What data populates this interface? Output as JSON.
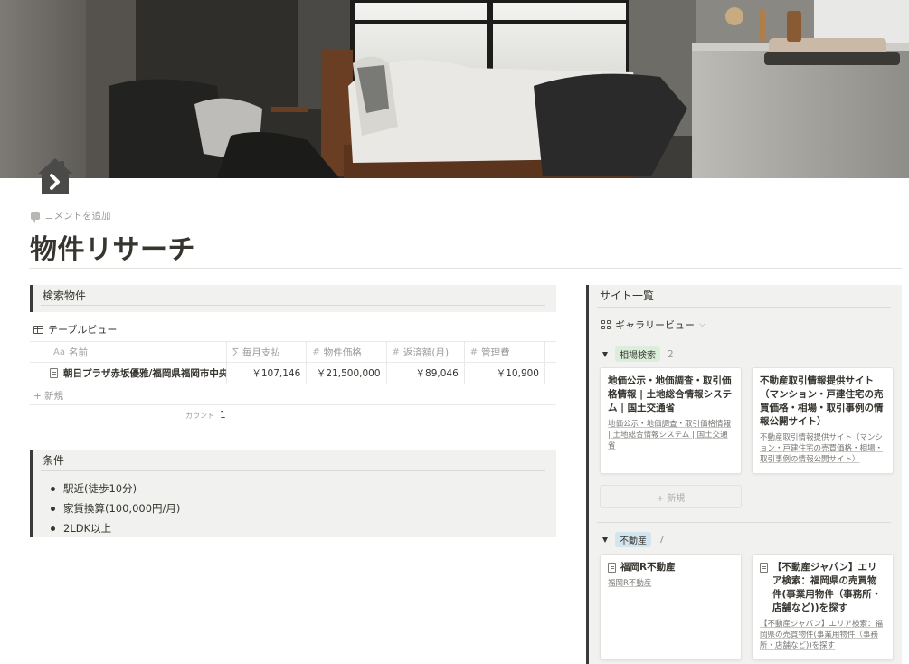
{
  "page": {
    "add_comment": "コメントを追加",
    "title": "物件リサーチ"
  },
  "search_section": {
    "heading": "検索物件",
    "view_label": "テーブルビュー",
    "columns": [
      {
        "icon": "Aa",
        "label": "名前"
      },
      {
        "icon": "∑",
        "label": "毎月支払"
      },
      {
        "icon": "#",
        "label": "物件価格"
      },
      {
        "icon": "#",
        "label": "返済額(月)"
      },
      {
        "icon": "#",
        "label": "管理費"
      }
    ],
    "rows": [
      {
        "name": "朝日プラザ赤坂優雅/福岡県福岡市中央区",
        "monthly": "￥107,146",
        "price": "￥21,500,000",
        "repayment": "￥89,046",
        "management": "￥10,900"
      }
    ],
    "new_label": "+ 新規",
    "count_label": "カウント",
    "count_value": "1"
  },
  "conditions": {
    "heading": "条件",
    "items": [
      "駅近(徒歩10分)",
      "家賃換算(100,000円/月)",
      "2LDK以上"
    ]
  },
  "sites": {
    "heading": "サイト一覧",
    "view_label": "ギャラリービュー",
    "groups": [
      {
        "tag": "相場検索",
        "count": "2",
        "cards": [
          {
            "title": "地価公示・地価調査・取引価格情報 | 土地総合情報システム | 国土交通省",
            "link": "地価公示・地価調査・取引価格情報 | 土地総合情報システム | 国土交通省"
          },
          {
            "title": "不動産取引情報提供サイト（マンション・戸建住宅の売買価格・相場・取引事例の情報公開サイト）",
            "link": "不動産取引情報提供サイト（マンション・戸建住宅の売買価格・相場・取引事例の情報公開サイト）"
          }
        ],
        "new_label": "+ 新規"
      },
      {
        "tag": "不動産",
        "count": "7",
        "cards": [
          {
            "title": "福岡R不動産",
            "link": "福岡R不動産"
          },
          {
            "title": "【不動産ジャパン】エリア検索：福岡県の売買物件(事業用物件（事務所・店舗など))を探す",
            "link": "【不動産ジャパン】エリア検索：福岡県の売買物件(事業用物件（事務所・店舗など))を探す"
          }
        ]
      }
    ]
  },
  "colors": {
    "text": "#37352f",
    "muted": "#9b9a97",
    "callout_bg": "#f1f1ef",
    "tag_green": "#dbeddb",
    "tag_blue": "#d3e5ef"
  },
  "icons": {
    "page_icon": "house-arrow-icon",
    "comment": "comment-icon",
    "table_view": "table-icon",
    "gallery_view": "gallery-icon",
    "page": "document-icon"
  }
}
